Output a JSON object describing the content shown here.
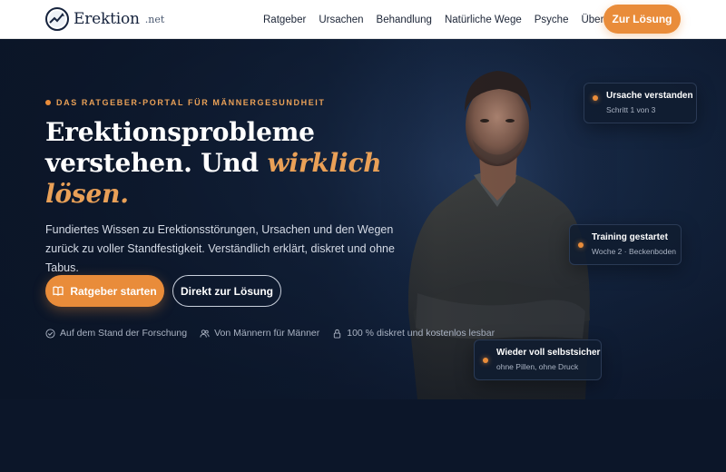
{
  "header": {
    "logo_text": "Erektion",
    "logo_suffix": ".net",
    "nav": [
      "Ratgeber",
      "Ursachen",
      "Behandlung",
      "Natürliche Wege",
      "Psyche",
      "Über uns"
    ],
    "cta_label": "Zur Lösung"
  },
  "hero": {
    "eyebrow": "DAS RATGEBER-PORTAL FÜR MÄNNERGESUNDHEIT",
    "headline_line1": "Erektionsprobleme",
    "headline_line2_plain": "verstehen. Und ",
    "headline_line2_accent": "wirklich",
    "headline_line3_accent": "lösen.",
    "lead": "Fundiertes Wissen zu Erektionsstörungen, Ursachen und den Wegen zurück zu voller Standfestigkeit. Verständlich erklärt, diskret und ohne Tabus.",
    "primary_button": "Ratgeber starten",
    "secondary_button": "Direkt zur Lösung",
    "trust": [
      {
        "icon": "check-circle-icon",
        "label": "Auf dem Stand der Forschung"
      },
      {
        "icon": "users-icon",
        "label": "Von Männern für Männer"
      },
      {
        "icon": "lock-icon",
        "label": "100 % diskret und kostenlos lesbar"
      }
    ]
  },
  "cards": [
    {
      "title": "Ursache verstanden",
      "sub": "Schritt 1 von 3"
    },
    {
      "title": "Training gestartet",
      "sub": "Woche 2 · Beckenboden"
    },
    {
      "title": "Wieder voll selbstsicher",
      "sub": "ohne Pillen, ohne Druck"
    }
  ],
  "colors": {
    "accent": "#e98c3a",
    "hero_bg": "#142540",
    "header_bg": "#ffffff"
  }
}
